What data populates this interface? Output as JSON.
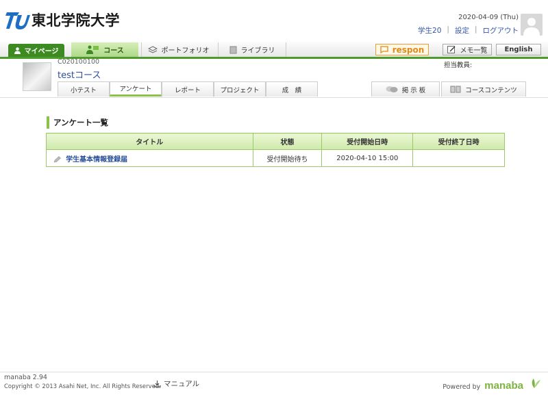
{
  "header": {
    "logo_text": "東北学院大学",
    "date": "2020-04-09 (Thu)",
    "links": [
      "学生20",
      "設定",
      "ログアウト"
    ]
  },
  "nav": {
    "mypage": "マイページ",
    "course": "コース",
    "portfolio": "ポートフォリオ",
    "library": "ライブラリ",
    "respon": "respon",
    "memo": "メモ一覧",
    "english": "English"
  },
  "course": {
    "code": "C020100100",
    "name": "testコース",
    "teacher_label": "担当教員:",
    "tabs": [
      "小テスト",
      "アンケート",
      "レポート",
      "プロジェクト",
      "成　績"
    ],
    "active_tab": "アンケート",
    "right_tabs": [
      "掲 示 板",
      "コースコンテンツ"
    ]
  },
  "survey": {
    "section_title": "アンケート一覧",
    "columns": [
      "タイトル",
      "状態",
      "受付開始日時",
      "受付終了日時"
    ],
    "rows": [
      {
        "title": "学生基本情報登録届",
        "status": "受付開始待ち",
        "start": "2020-04-10 15:00",
        "end": ""
      }
    ]
  },
  "footer": {
    "version": "manaba 2.94",
    "copyright": "Copyright © 2013 Asahi Net, Inc. All Rights Reserved.",
    "manual": "マニュアル",
    "powered_label": "Powered by",
    "powered_brand": "manaba"
  },
  "colors": {
    "accent_green": "#4e9a2a",
    "table_header": "#cfeaaa",
    "link_blue": "#2a4f9a",
    "respon_orange": "#e28a1a"
  }
}
